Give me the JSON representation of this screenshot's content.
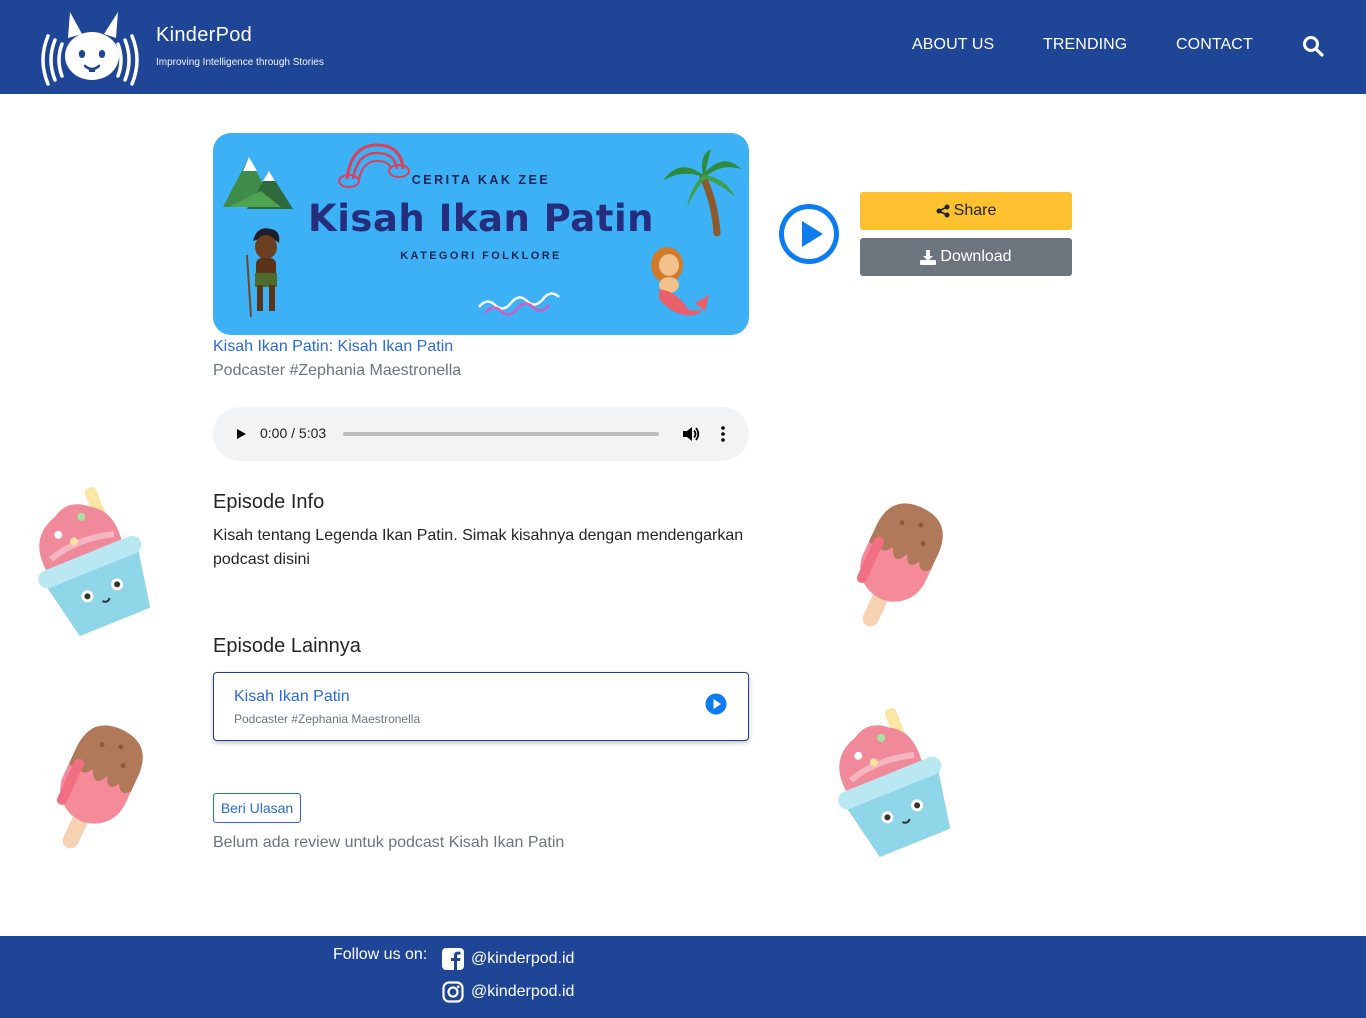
{
  "header": {
    "brand_name": "KinderPod",
    "brand_tagline": "Improving Intelligence through Stories",
    "nav": {
      "about": "ABOUT US",
      "trending": "TRENDING",
      "contact": "CONTACT"
    }
  },
  "cover": {
    "kicker": "CERITA KAK ZEE",
    "title": "Kisah Ikan Patin",
    "subtitle": "KATEGORI FOLKLORE"
  },
  "episode": {
    "title": "Kisah Ikan Patin: Kisah Ikan Patin",
    "podcaster": "Podcaster #Zephania Maestronella"
  },
  "actions": {
    "share": "Share",
    "download": "Download"
  },
  "audio": {
    "time": "0:00 / 5:03",
    "progress": 0
  },
  "info": {
    "heading": "Episode Info",
    "text": "Kisah tentang Legenda Ikan Patin. Simak kisahnya dengan mendengarkan podcast disini"
  },
  "others": {
    "heading": "Episode Lainnya",
    "items": [
      {
        "title": "Kisah Ikan Patin",
        "podcaster": "Podcaster #Zephania Maestronella"
      }
    ]
  },
  "review": {
    "button": "Beri Ulasan",
    "empty": "Belum ada review untuk podcast Kisah Ikan Patin"
  },
  "footer": {
    "follow": "Follow us on:",
    "facebook": "@kinderpod.id",
    "instagram": "@kinderpod.id"
  },
  "colors": {
    "navbar": "#1f4696",
    "cover_bg": "#3cb1f5",
    "primary": "#0d7cf0",
    "warning": "#fdc130",
    "secondary": "#6c757d"
  }
}
